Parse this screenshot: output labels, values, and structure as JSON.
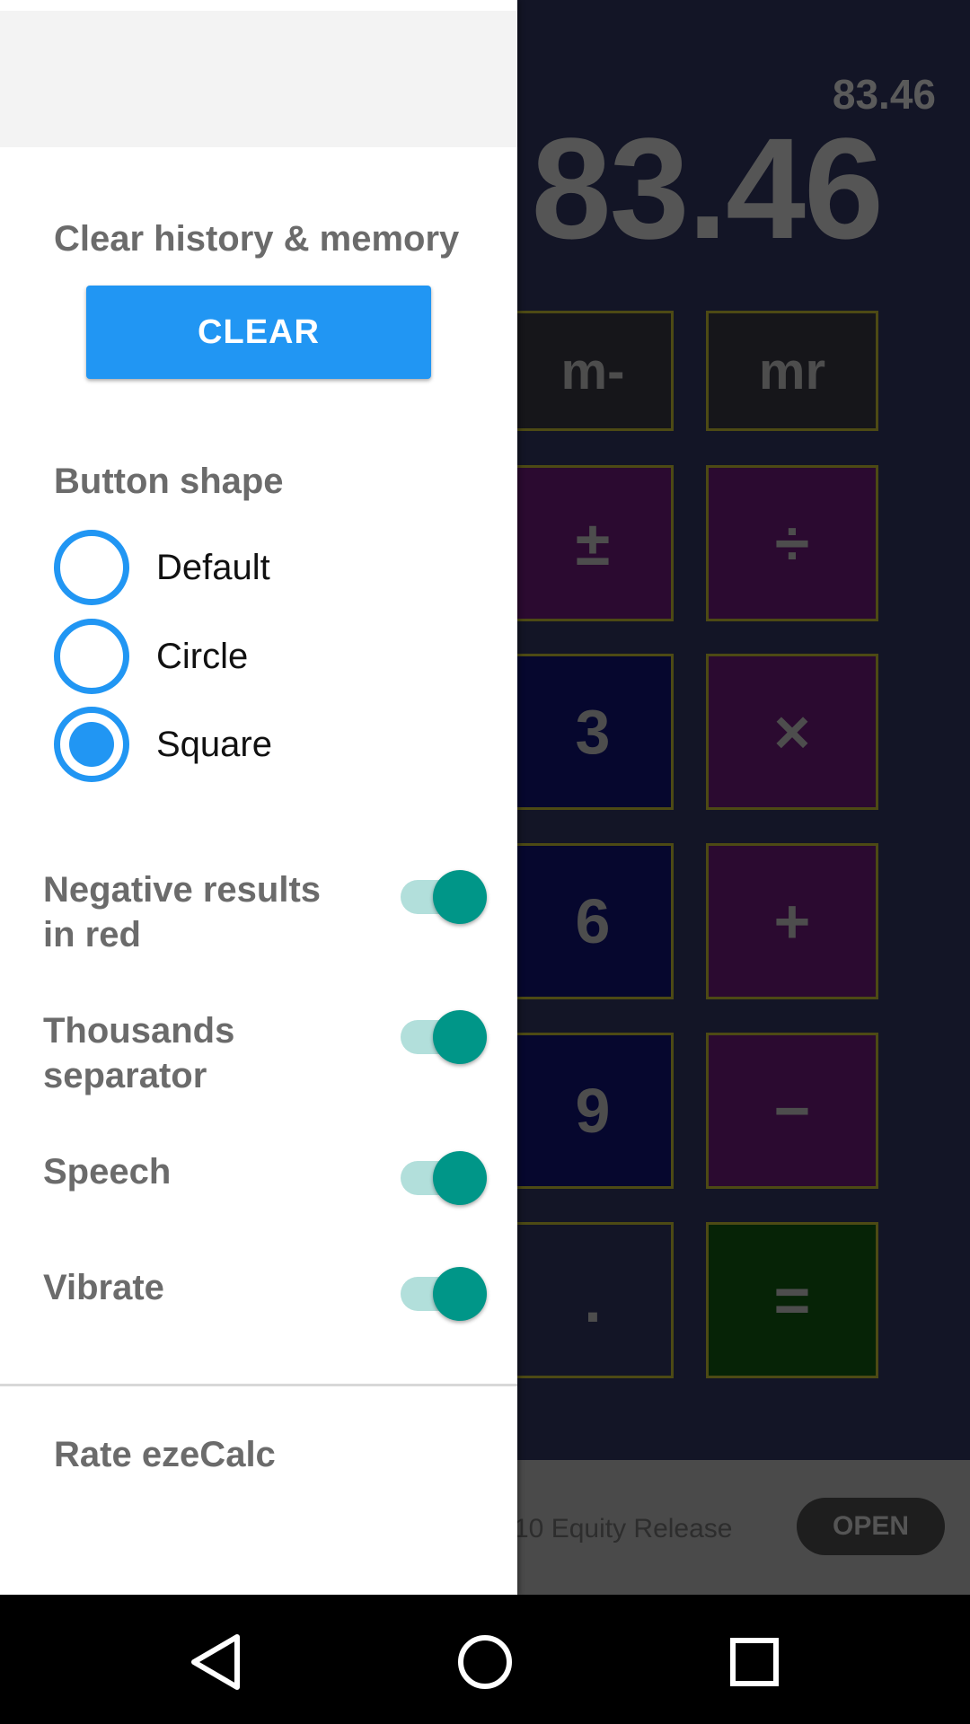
{
  "calculator": {
    "history_value": "83.46",
    "display_value": "83.46",
    "keys": {
      "m_minus": "m-",
      "mr": "mr",
      "plus_minus": "±",
      "divide": "÷",
      "three": "3",
      "multiply": "×",
      "six": "6",
      "plus": "+",
      "nine": "9",
      "minus": "−",
      "dot": ".",
      "equals": "="
    }
  },
  "ad": {
    "text": "10 Equity Release",
    "open_label": "OPEN"
  },
  "drawer": {
    "clear_section_title": "Clear history & memory",
    "clear_button_label": "CLEAR",
    "button_shape_title": "Button shape",
    "shape_options": [
      {
        "label": "Default",
        "selected": false
      },
      {
        "label": "Circle",
        "selected": false
      },
      {
        "label": "Square",
        "selected": true
      }
    ],
    "toggles": [
      {
        "label_line1": "Negative results",
        "label_line2": "in red",
        "on": true
      },
      {
        "label_line1": "Thousands",
        "label_line2": "separator",
        "on": true
      },
      {
        "label_line1": "Speech",
        "label_line2": "",
        "on": true
      },
      {
        "label_line1": "Vibrate",
        "label_line2": "",
        "on": true
      }
    ],
    "rate_label": "Rate ezeCalc"
  },
  "colors": {
    "accent_blue": "#2196f3",
    "switch_thumb": "#009688",
    "switch_track": "#b2dfdb"
  },
  "icons": {
    "back": "back-triangle-icon",
    "home": "home-circle-icon",
    "recents": "recents-square-icon"
  }
}
